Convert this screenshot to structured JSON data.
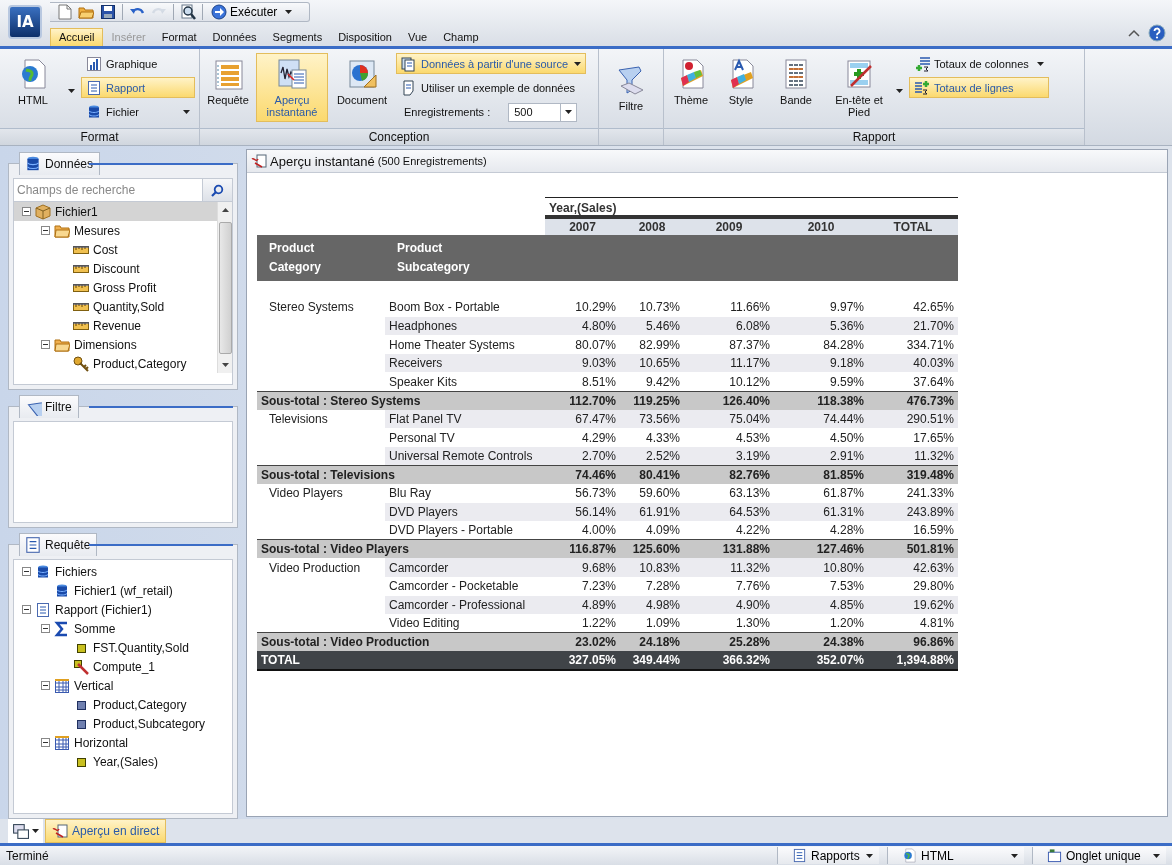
{
  "logo": "IA",
  "quick_access": {
    "tools": [
      {
        "kind": "new",
        "disabled": false
      },
      {
        "kind": "open",
        "disabled": false
      },
      {
        "kind": "save",
        "disabled": false
      },
      {
        "kind": "undo",
        "disabled": false
      },
      {
        "kind": "redo",
        "disabled": true
      },
      {
        "kind": "preview",
        "disabled": false
      }
    ],
    "run_label": "Exécuter"
  },
  "menu_tabs": [
    {
      "label": "Accueil",
      "selected": true,
      "disabled": false
    },
    {
      "label": "Insérer",
      "selected": false,
      "disabled": true
    },
    {
      "label": "Format",
      "selected": false,
      "disabled": false
    },
    {
      "label": "Données",
      "selected": false,
      "disabled": false
    },
    {
      "label": "Segments",
      "selected": false,
      "disabled": false
    },
    {
      "label": "Disposition",
      "selected": false,
      "disabled": false
    },
    {
      "label": "Vue",
      "selected": false,
      "disabled": false
    },
    {
      "label": "Champ",
      "selected": false,
      "disabled": false
    }
  ],
  "ribbon": {
    "format": {
      "title": "Format",
      "html_label": "HTML",
      "items": [
        {
          "label": "Graphique",
          "kind": "chart",
          "selected": false
        },
        {
          "label": "Rapport",
          "kind": "report",
          "selected": true
        },
        {
          "label": "Fichier",
          "kind": "db",
          "selected": false
        }
      ]
    },
    "conception": {
      "title": "Conception",
      "buttons": [
        {
          "label": "Requête",
          "kind": "query",
          "selected": false
        },
        {
          "label": "Aperçu instantané",
          "kind": "preview",
          "selected": true
        },
        {
          "label": "Document",
          "kind": "document",
          "selected": false
        }
      ],
      "source": {
        "label": "Données à partir d'une source",
        "selected": true
      },
      "sample_label": "Utiliser un exemple de données",
      "records": {
        "label": "Enregistrements :",
        "value": "500"
      }
    },
    "filter_label": "Filtre",
    "rapport": {
      "title": "Rapport",
      "buttons": [
        {
          "label": "Thème",
          "kind": "theme"
        },
        {
          "label": "Style",
          "kind": "style"
        },
        {
          "label": "Bande",
          "kind": "band"
        },
        {
          "label": "En-tête et Pied",
          "kind": "headfoot"
        }
      ],
      "totals": [
        {
          "label": "Totaux de colonnes",
          "kind": "coltot",
          "selected": false
        },
        {
          "label": "Totaux de lignes",
          "kind": "rowtot",
          "selected": true
        }
      ]
    }
  },
  "data_panel": {
    "title": "Données",
    "search_placeholder": "Champs de recherche",
    "tree": [
      {
        "label": "Fichier1",
        "kind": "cube",
        "selected": true,
        "expanded": true,
        "children": [
          {
            "label": "Mesures",
            "kind": "folder",
            "selected": false,
            "expanded": true,
            "children": [
              {
                "label": "Cost",
                "kind": "ruler",
                "selected": false
              },
              {
                "label": "Discount",
                "kind": "ruler",
                "selected": false
              },
              {
                "label": "Gross Profit",
                "kind": "ruler",
                "selected": false
              },
              {
                "label": "Quantity,Sold",
                "kind": "ruler",
                "selected": false
              },
              {
                "label": "Revenue",
                "kind": "ruler",
                "selected": false
              }
            ]
          },
          {
            "label": "Dimensions",
            "kind": "folder",
            "selected": false,
            "expanded": true,
            "children": [
              {
                "label": "Product,Category",
                "kind": "key",
                "selected": false
              }
            ]
          }
        ]
      }
    ]
  },
  "filter_panel": {
    "title": "Filtre"
  },
  "query_panel": {
    "title": "Requête",
    "tree": [
      {
        "label": "Fichiers",
        "kind": "db",
        "selected": false,
        "expanded": true,
        "children": [
          {
            "label": "Fichier1 (wf_retail)",
            "kind": "db",
            "selected": false
          }
        ]
      },
      {
        "label": "Rapport (Fichier1)",
        "kind": "doc",
        "selected": false,
        "expanded": true,
        "children": [
          {
            "label": "Somme",
            "kind": "sigma",
            "selected": false,
            "expanded": true,
            "children": [
              {
                "label": "FST.Quantity,Sold",
                "kind": "measure",
                "selected": false
              },
              {
                "label": "Compute_1",
                "kind": "compute",
                "selected": false
              }
            ]
          },
          {
            "label": "Vertical",
            "kind": "grid",
            "selected": false,
            "expanded": true,
            "children": [
              {
                "label": "Product,Category",
                "kind": "dimension",
                "selected": false
              },
              {
                "label": "Product,Subcategory",
                "kind": "dimension",
                "selected": false
              }
            ]
          },
          {
            "label": "Horizontal",
            "kind": "grid",
            "selected": false,
            "expanded": true,
            "children": [
              {
                "label": "Year,(Sales)",
                "kind": "measure",
                "selected": false
              }
            ]
          }
        ]
      }
    ]
  },
  "preview": {
    "title": "Aperçu instantané",
    "subtitle": "(500 Enregistrements)",
    "report": {
      "across_title": "Year,(Sales)",
      "columns": [
        "2007",
        "2008",
        "2009",
        "2010",
        "TOTAL"
      ],
      "row_headers": [
        "Product Category",
        "Product Subcategory"
      ],
      "rows": [
        {
          "kind": "detail",
          "category": "Stereo Systems",
          "subcategory": "Boom Box - Portable",
          "values": [
            "10.29%",
            "10.73%",
            "11.66%",
            "9.97%",
            "42.65%"
          ]
        },
        {
          "kind": "detail",
          "subcategory": "Headphones",
          "values": [
            "4.80%",
            "5.46%",
            "6.08%",
            "5.36%",
            "21.70%"
          ]
        },
        {
          "kind": "detail",
          "subcategory": "Home Theater Systems",
          "values": [
            "80.07%",
            "82.99%",
            "87.37%",
            "84.28%",
            "334.71%"
          ]
        },
        {
          "kind": "detail",
          "subcategory": "Receivers",
          "values": [
            "9.03%",
            "10.65%",
            "11.17%",
            "9.18%",
            "40.03%"
          ]
        },
        {
          "kind": "detail",
          "subcategory": "Speaker Kits",
          "values": [
            "8.51%",
            "9.42%",
            "10.12%",
            "9.59%",
            "37.64%"
          ]
        },
        {
          "kind": "subtotal",
          "label": "Sous-total : Stereo Systems",
          "values": [
            "112.70%",
            "119.25%",
            "126.40%",
            "118.38%",
            "476.73%"
          ]
        },
        {
          "kind": "detail",
          "category": "Televisions",
          "subcategory": "Flat Panel TV",
          "values": [
            "67.47%",
            "73.56%",
            "75.04%",
            "74.44%",
            "290.51%"
          ]
        },
        {
          "kind": "detail",
          "subcategory": "Personal TV",
          "values": [
            "4.29%",
            "4.33%",
            "4.53%",
            "4.50%",
            "17.65%"
          ]
        },
        {
          "kind": "detail",
          "subcategory": "Universal Remote Controls",
          "values": [
            "2.70%",
            "2.52%",
            "3.19%",
            "2.91%",
            "11.32%"
          ]
        },
        {
          "kind": "subtotal",
          "label": "Sous-total : Televisions",
          "values": [
            "74.46%",
            "80.41%",
            "82.76%",
            "81.85%",
            "319.48%"
          ]
        },
        {
          "kind": "detail",
          "category": "Video Players",
          "subcategory": "Blu Ray",
          "values": [
            "56.73%",
            "59.60%",
            "63.13%",
            "61.87%",
            "241.33%"
          ]
        },
        {
          "kind": "detail",
          "subcategory": "DVD Players",
          "values": [
            "56.14%",
            "61.91%",
            "64.53%",
            "61.31%",
            "243.89%"
          ]
        },
        {
          "kind": "detail",
          "subcategory": "DVD Players - Portable",
          "values": [
            "4.00%",
            "4.09%",
            "4.22%",
            "4.28%",
            "16.59%"
          ]
        },
        {
          "kind": "subtotal",
          "label": "Sous-total : Video Players",
          "values": [
            "116.87%",
            "125.60%",
            "131.88%",
            "127.46%",
            "501.81%"
          ]
        },
        {
          "kind": "detail",
          "category": "Video Production",
          "subcategory": "Camcorder",
          "values": [
            "9.68%",
            "10.83%",
            "11.32%",
            "10.80%",
            "42.63%"
          ]
        },
        {
          "kind": "detail",
          "subcategory": "Camcorder - Pocketable",
          "values": [
            "7.23%",
            "7.28%",
            "7.76%",
            "7.53%",
            "29.80%"
          ]
        },
        {
          "kind": "detail",
          "subcategory": "Camcorder - Professional",
          "values": [
            "4.89%",
            "4.98%",
            "4.90%",
            "4.85%",
            "19.62%"
          ]
        },
        {
          "kind": "detail",
          "subcategory": "Video Editing",
          "values": [
            "1.22%",
            "1.09%",
            "1.30%",
            "1.20%",
            "4.81%"
          ]
        },
        {
          "kind": "subtotal",
          "label": "Sous-total : Video Production",
          "values": [
            "23.02%",
            "24.18%",
            "25.28%",
            "24.38%",
            "96.86%"
          ]
        },
        {
          "kind": "total",
          "label": "TOTAL",
          "values": [
            "327.05%",
            "349.44%",
            "366.32%",
            "352.07%",
            "1,394.88%"
          ]
        }
      ]
    }
  },
  "bottom_tabs": [
    {
      "label": "Aperçu en direct",
      "selected": true
    }
  ],
  "status_bar": {
    "text": "Terminé",
    "dropdowns": [
      {
        "label": "Rapports",
        "kind": "report"
      },
      {
        "label": "HTML",
        "kind": "html"
      },
      {
        "label": "Onglet unique",
        "kind": "tab"
      }
    ]
  }
}
